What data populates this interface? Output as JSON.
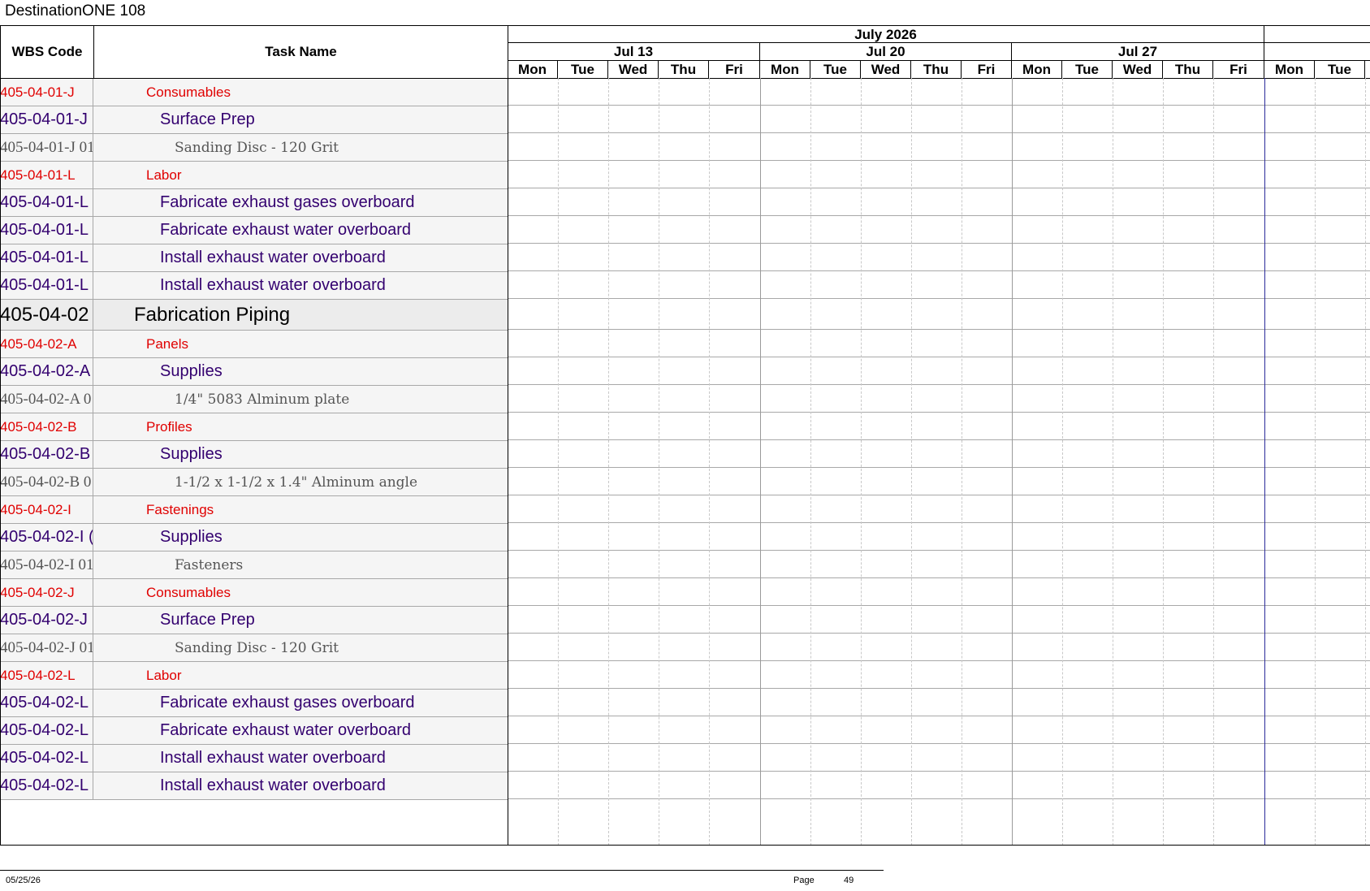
{
  "document": {
    "title": "DestinationONE 108"
  },
  "columns": {
    "wbs_header": "WBS Code",
    "task_header": "Task Name"
  },
  "timeline": {
    "month": "July 2026",
    "weeks": [
      {
        "label": "Jul 13",
        "days": [
          "Mon",
          "Tue",
          "Wed",
          "Thu",
          "Fri"
        ]
      },
      {
        "label": "Jul 20",
        "days": [
          "Mon",
          "Tue",
          "Wed",
          "Thu",
          "Fri"
        ]
      },
      {
        "label": "Jul 27",
        "days": [
          "Mon",
          "Tue",
          "Wed",
          "Thu",
          "Fri"
        ]
      },
      {
        "label": "",
        "days": [
          "Mon",
          "Tue"
        ]
      }
    ]
  },
  "rows": [
    {
      "wbs": "405-04-01-J",
      "task": "Consumables",
      "level": 1
    },
    {
      "wbs": "405-04-01-J",
      "task": "Surface Prep",
      "level": 2
    },
    {
      "wbs": "405-04-01-J 01",
      "task": "Sanding Disc - 120 Grit",
      "level": 3
    },
    {
      "wbs": "405-04-01-L",
      "task": "Labor",
      "level": 1
    },
    {
      "wbs": "405-04-01-L",
      "task": "Fabricate exhaust gases overboard",
      "level": 2
    },
    {
      "wbs": "405-04-01-L",
      "task": "Fabricate exhaust water overboard",
      "level": 2
    },
    {
      "wbs": "405-04-01-L",
      "task": "Install exhaust water overboard",
      "level": 2
    },
    {
      "wbs": "405-04-01-L",
      "task": "Install exhaust water overboard",
      "level": 2
    },
    {
      "wbs": "405-04-02",
      "task": "Fabrication Piping",
      "level": 0
    },
    {
      "wbs": "405-04-02-A",
      "task": "Panels",
      "level": 1
    },
    {
      "wbs": "405-04-02-A",
      "task": "Supplies",
      "level": 2
    },
    {
      "wbs": "405-04-02-A 0",
      "task": "1/4\" 5083 Alminum plate",
      "level": 3
    },
    {
      "wbs": "405-04-02-B",
      "task": "Profiles",
      "level": 1
    },
    {
      "wbs": "405-04-02-B",
      "task": "Supplies",
      "level": 2
    },
    {
      "wbs": "405-04-02-B 0",
      "task": "1-1/2 x 1-1/2 x 1.4\" Alminum angle",
      "level": 3
    },
    {
      "wbs": "405-04-02-I",
      "task": "Fastenings",
      "level": 1
    },
    {
      "wbs": "405-04-02-I (",
      "task": "Supplies",
      "level": 2
    },
    {
      "wbs": "405-04-02-I 01",
      "task": "Fasteners",
      "level": 3
    },
    {
      "wbs": "405-04-02-J",
      "task": "Consumables",
      "level": 1
    },
    {
      "wbs": "405-04-02-J",
      "task": "Surface Prep",
      "level": 2
    },
    {
      "wbs": "405-04-02-J 01",
      "task": "Sanding Disc - 120 Grit",
      "level": 3
    },
    {
      "wbs": "405-04-02-L",
      "task": "Labor",
      "level": 1
    },
    {
      "wbs": "405-04-02-L",
      "task": "Fabricate exhaust gases overboard",
      "level": 2
    },
    {
      "wbs": "405-04-02-L",
      "task": "Fabricate exhaust water overboard",
      "level": 2
    },
    {
      "wbs": "405-04-02-L",
      "task": "Install exhaust water overboard",
      "level": 2
    },
    {
      "wbs": "405-04-02-L",
      "task": "Install exhaust water overboard",
      "level": 2
    }
  ],
  "footer": {
    "date": "05/25/26",
    "page_label": "Page",
    "page_number": "49"
  },
  "colors": {
    "level0": "#000000",
    "level1": "#e00000",
    "level2": "#33006f",
    "level3": "#555555",
    "month_divider": "#2b2b9a"
  }
}
